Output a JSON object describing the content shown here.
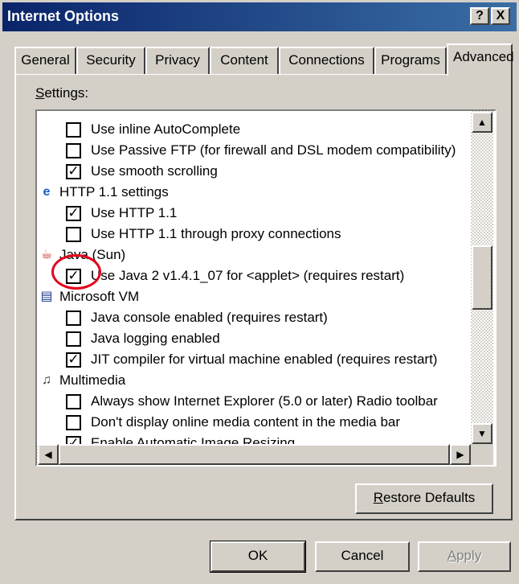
{
  "window": {
    "title": "Internet Options",
    "help_btn": "?",
    "close_btn": "X"
  },
  "tabs": [
    {
      "label": "General"
    },
    {
      "label": "Security"
    },
    {
      "label": "Privacy"
    },
    {
      "label": "Content"
    },
    {
      "label": "Connections"
    },
    {
      "label": "Programs"
    },
    {
      "label": "Advanced"
    }
  ],
  "active_tab": "Advanced",
  "settings": {
    "label_mnemonic": "S",
    "label_rest": "ettings:",
    "items": [
      {
        "type": "option",
        "label": "Use inline AutoComplete",
        "checked": false
      },
      {
        "type": "option",
        "label": "Use Passive FTP (for firewall and DSL modem compatibility)",
        "checked": false
      },
      {
        "type": "option",
        "label": "Use smooth scrolling",
        "checked": true
      },
      {
        "type": "category",
        "label": "HTTP 1.1 settings",
        "icon": "ie-globe-icon"
      },
      {
        "type": "option",
        "label": "Use HTTP 1.1",
        "checked": true
      },
      {
        "type": "option",
        "label": "Use HTTP 1.1 through proxy connections",
        "checked": false
      },
      {
        "type": "category",
        "label": "Java (Sun)",
        "icon": "java-cup-icon"
      },
      {
        "type": "option",
        "label": "Use Java 2 v1.4.1_07 for <applet> (requires restart)",
        "checked": true
      },
      {
        "type": "category",
        "label": "Microsoft VM",
        "icon": "document-icon"
      },
      {
        "type": "option",
        "label": "Java console enabled (requires restart)",
        "checked": false
      },
      {
        "type": "option",
        "label": "Java logging enabled",
        "checked": false
      },
      {
        "type": "option",
        "label": "JIT compiler for virtual machine enabled (requires restart)",
        "checked": true
      },
      {
        "type": "category",
        "label": "Multimedia",
        "icon": "multimedia-icon"
      },
      {
        "type": "option",
        "label": "Always show Internet Explorer (5.0 or later) Radio toolbar",
        "checked": false
      },
      {
        "type": "option",
        "label": "Don't display online media content in the media bar",
        "checked": false
      },
      {
        "type": "option",
        "label": "Enable Automatic Image Resizing",
        "checked": true
      }
    ]
  },
  "buttons": {
    "restore_mnemonic": "R",
    "restore_rest": "estore Defaults",
    "ok": "OK",
    "cancel": "Cancel",
    "apply_mnemonic": "A",
    "apply_rest": "pply"
  },
  "scroll_arrows": {
    "up": "▲",
    "down": "▼",
    "left": "◀",
    "right": "▶"
  },
  "colors": {
    "titlebar_start": "#0a246a",
    "titlebar_end": "#3a6ea5",
    "dialog_face": "#d4d0c8",
    "highlight_circle": "#e3001b"
  }
}
